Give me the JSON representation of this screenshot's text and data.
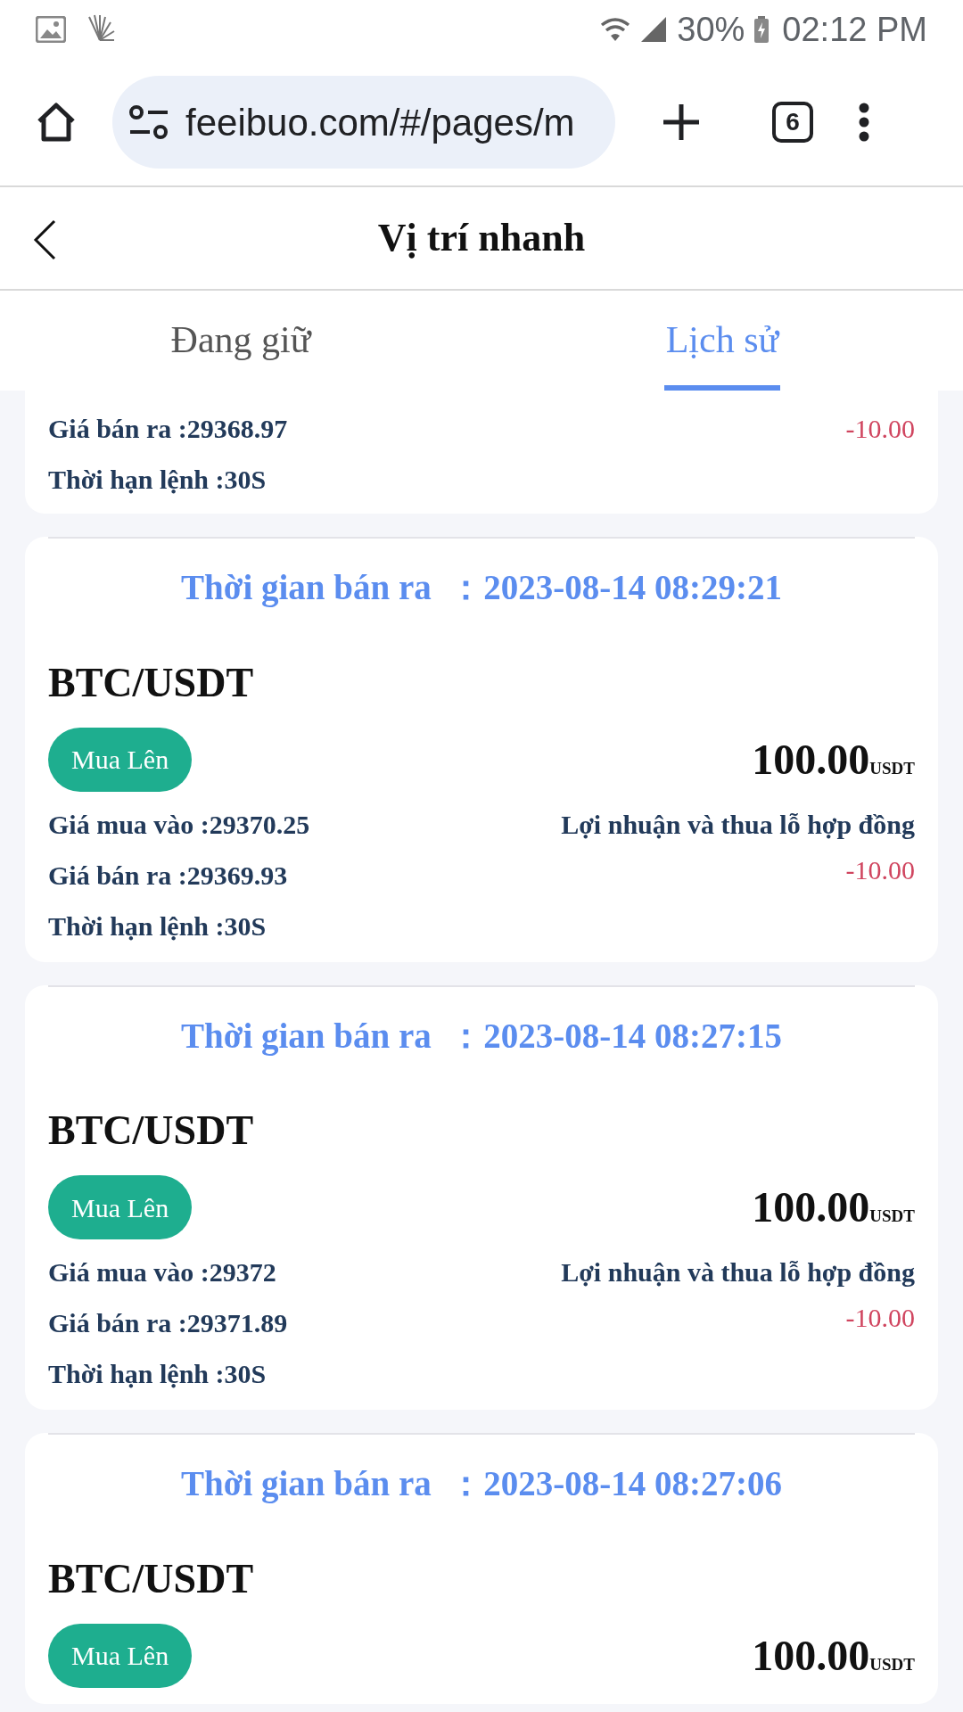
{
  "status_bar": {
    "battery": "30%",
    "time": "02:12 PM"
  },
  "browser": {
    "url": "feeibuo.com/#/pages/m",
    "tab_count": "6"
  },
  "header": {
    "title": "Vị trí nhanh"
  },
  "tabs": [
    {
      "label": "Đang giữ",
      "selected": false
    },
    {
      "label": "Lịch sử",
      "selected": true
    }
  ],
  "orders": [
    {
      "sell_price": "Giá bán ra :29368.97",
      "pnl": "-10.00",
      "duration": "Thời hạn lệnh :30S"
    },
    {
      "sell_time": "Thời gian bán ra  ：2023-08-14 08:29:21",
      "pair": "BTC/USDT",
      "direction": "Mua Lên",
      "amount": "100.00",
      "unit": "USDT",
      "buy_price": "Giá mua vào :29370.25",
      "pnl_label": "Lợi nhuận và thua lỗ hợp đồng",
      "sell_price": "Giá bán ra :29369.93",
      "pnl": "-10.00",
      "duration": "Thời hạn lệnh :30S"
    },
    {
      "sell_time": "Thời gian bán ra  ：2023-08-14 08:27:15",
      "pair": "BTC/USDT",
      "direction": "Mua Lên",
      "amount": "100.00",
      "unit": "USDT",
      "buy_price": "Giá mua vào :29372",
      "pnl_label": "Lợi nhuận và thua lỗ hợp đồng",
      "sell_price": "Giá bán ra :29371.89",
      "pnl": "-10.00",
      "duration": "Thời hạn lệnh :30S"
    },
    {
      "sell_time": "Thời gian bán ra  ：2023-08-14 08:27:06",
      "pair": "BTC/USDT",
      "direction": "Mua Lên",
      "amount": "100.00",
      "unit": "USDT"
    }
  ]
}
